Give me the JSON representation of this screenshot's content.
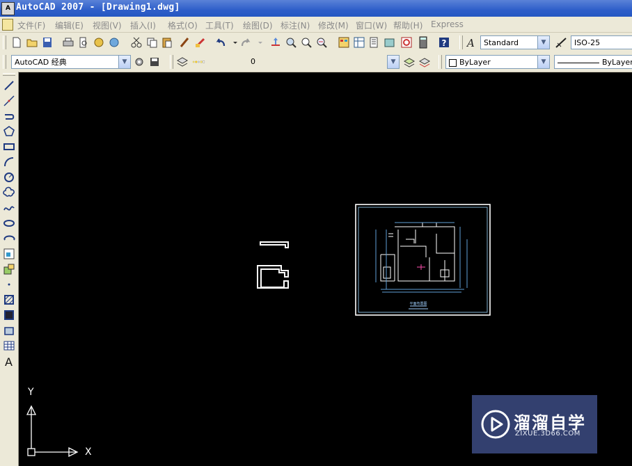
{
  "window": {
    "title": "AutoCAD 2007 - [Drawing1.dwg]",
    "app_icon": "AutoCAD-app-icon"
  },
  "menu": {
    "items": [
      "文件(F)",
      "编辑(E)",
      "视图(V)",
      "插入(I)",
      "格式(O)",
      "工具(T)",
      "绘图(D)",
      "标注(N)",
      "修改(M)",
      "窗口(W)",
      "帮助(H)",
      "Express"
    ]
  },
  "toolbar": {
    "text_style": "Standard",
    "dim_style": "ISO-25",
    "workspace": "AutoCAD 经典",
    "layer": "0",
    "color": "ByLayer",
    "linetype": "ByLayer"
  },
  "canvas": {
    "background_color": "#000000",
    "ucs_x_label": "X",
    "ucs_y_label": "Y"
  },
  "plan": {
    "title_text": "平面布置图"
  },
  "watermark": {
    "title": "溜溜自学",
    "subtitle": "ZIXUE.3D66.COM"
  }
}
